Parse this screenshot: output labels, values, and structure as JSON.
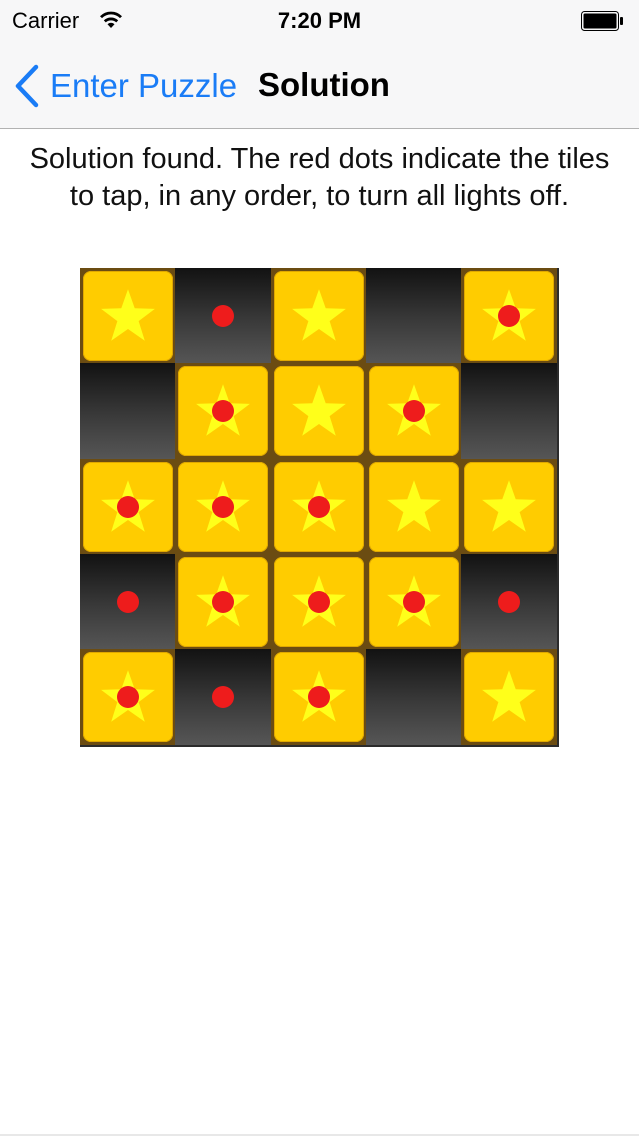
{
  "status_bar": {
    "carrier": "Carrier",
    "time": "7:20 PM",
    "wifi_icon": "wifi-icon",
    "battery_icon": "battery-icon"
  },
  "nav": {
    "back_label": "Enter Puzzle",
    "back_icon": "chevron-left-icon",
    "title": "Solution"
  },
  "message": "Solution found. The red dots indicate the tiles to tap, in any order, to turn all lights off.",
  "colors": {
    "accent": "#1a7cf6",
    "tile_on": "#ffcc00",
    "star": "#ffff1a",
    "tap_dot": "#ee1c1c"
  },
  "board": {
    "rows": 5,
    "cols": 5,
    "lights": [
      [
        true,
        false,
        true,
        false,
        true
      ],
      [
        false,
        true,
        true,
        true,
        false
      ],
      [
        true,
        true,
        true,
        true,
        true
      ],
      [
        false,
        true,
        true,
        true,
        false
      ],
      [
        true,
        false,
        true,
        false,
        true
      ]
    ],
    "taps": [
      [
        false,
        true,
        false,
        false,
        true
      ],
      [
        false,
        true,
        false,
        true,
        false
      ],
      [
        true,
        true,
        true,
        false,
        false
      ],
      [
        true,
        true,
        true,
        true,
        true
      ],
      [
        true,
        true,
        true,
        false,
        false
      ]
    ]
  }
}
